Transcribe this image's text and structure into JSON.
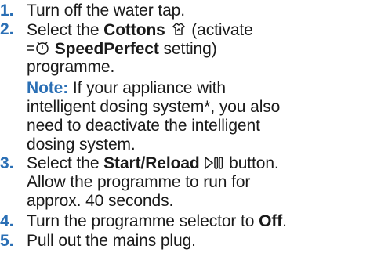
{
  "steps": [
    {
      "num": "1.",
      "text": "Turn off the water tap."
    },
    {
      "num": "2.",
      "pre": "Select the ",
      "bold1": "Cottons",
      "post1": " (activate",
      "bold2": "SpeedPerfect",
      "post2": " setting)",
      "line3": "programme.",
      "note_label": "Note:",
      "note_l1": " If your appliance with",
      "note_l2": "intelligent dosing system*, you also",
      "note_l3": "need to deactivate the intelligent",
      "note_l4": "dosing system."
    },
    {
      "num": "3.",
      "pre": "Select the ",
      "bold": "Start/Reload",
      "post": " button.",
      "line2": "Allow the programme to run for",
      "line3": "approx. 40 seconds."
    },
    {
      "num": "4.",
      "pre": "Turn the programme selector to ",
      "bold": "Off",
      "post": "."
    },
    {
      "num": "5.",
      "text": "Pull out the mains plug."
    }
  ],
  "icons": [
    "cottons-icon",
    "speedperfect-icon",
    "start-reload-icon"
  ],
  "colors": {
    "number": "#2a6fb5",
    "text": "#1a1a1a"
  }
}
